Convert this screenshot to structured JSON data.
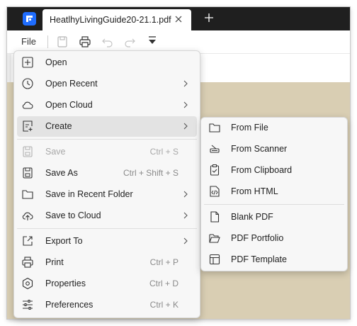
{
  "tab": {
    "title": "HeatlhyLivingGuide20-21.1.pdf"
  },
  "toolbar": {
    "file_label": "File"
  },
  "file_menu": {
    "items": [
      {
        "label": "Open",
        "icon": "plus-square-icon",
        "shortcut": "",
        "submenu": false,
        "disabled": false
      },
      {
        "label": "Open Recent",
        "icon": "clock-icon",
        "shortcut": "",
        "submenu": true,
        "disabled": false
      },
      {
        "label": "Open Cloud",
        "icon": "cloud-icon",
        "shortcut": "",
        "submenu": true,
        "disabled": false
      },
      {
        "label": "Create",
        "icon": "create-file-icon",
        "shortcut": "",
        "submenu": true,
        "disabled": false,
        "active": true
      },
      {
        "label": "Save",
        "icon": "save-icon",
        "shortcut": "Ctrl + S",
        "submenu": false,
        "disabled": true
      },
      {
        "label": "Save As",
        "icon": "save-as-icon",
        "shortcut": "Ctrl + Shift + S",
        "submenu": false,
        "disabled": false
      },
      {
        "label": "Save in Recent Folder",
        "icon": "folder-icon",
        "shortcut": "",
        "submenu": true,
        "disabled": false
      },
      {
        "label": "Save to Cloud",
        "icon": "cloud-upload-icon",
        "shortcut": "",
        "submenu": true,
        "disabled": false
      },
      {
        "label": "Export To",
        "icon": "export-icon",
        "shortcut": "",
        "submenu": true,
        "disabled": false
      },
      {
        "label": "Print",
        "icon": "print-icon",
        "shortcut": "Ctrl + P",
        "submenu": false,
        "disabled": false
      },
      {
        "label": "Properties",
        "icon": "properties-icon",
        "shortcut": "Ctrl + D",
        "submenu": false,
        "disabled": false
      },
      {
        "label": "Preferences",
        "icon": "preferences-icon",
        "shortcut": "Ctrl + K",
        "submenu": false,
        "disabled": false
      }
    ]
  },
  "create_submenu": {
    "items": [
      {
        "label": "From File",
        "icon": "folder-icon"
      },
      {
        "label": "From Scanner",
        "icon": "scanner-icon"
      },
      {
        "label": "From Clipboard",
        "icon": "clipboard-icon"
      },
      {
        "label": "From HTML",
        "icon": "html-file-icon"
      },
      {
        "label": "Blank PDF",
        "icon": "blank-pdf-icon"
      },
      {
        "label": "PDF Portfolio",
        "icon": "portfolio-folder-icon"
      },
      {
        "label": "PDF Template",
        "icon": "template-icon"
      }
    ]
  },
  "colors": {
    "accent": "#1f6dff",
    "tabbar": "#1f1f1f",
    "document_bg": "#d9ceb3",
    "menu_bg": "#f7f7f7",
    "active_item": "#e3e3e3"
  }
}
